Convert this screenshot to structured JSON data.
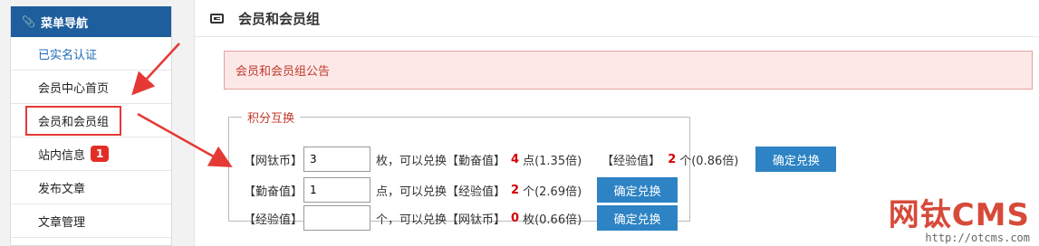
{
  "sidebar": {
    "header": "菜单导航",
    "items": [
      {
        "label": "已实名认证"
      },
      {
        "label": "会员中心首页"
      },
      {
        "label": "会员和会员组"
      },
      {
        "label": "站内信息",
        "badge": "1"
      },
      {
        "label": "发布文章"
      },
      {
        "label": "文章管理"
      }
    ]
  },
  "main": {
    "title": "会员和会员组",
    "notice": "会员和会员组公告",
    "legend": "积分互换",
    "rows": [
      {
        "label": "【网钛币】",
        "value": "3",
        "unit_text": "枚，可以兑换【勤奋值】",
        "num1": "4",
        "tail1": "点(1.35倍)",
        "label2": "【经验值】",
        "num2": "2",
        "tail2": "个(0.86倍)",
        "button": "确定兑换"
      },
      {
        "label": "【勤奋值】",
        "value": "1",
        "unit_text": "点，可以兑换【经验值】",
        "num1": "2",
        "tail1": "个(2.69倍)",
        "button": "确定兑换"
      },
      {
        "label": "【经验值】",
        "value": "",
        "unit_text": "个，可以兑换【网钛币】",
        "num1": "0",
        "tail1": "枚(0.66倍)",
        "button": "确定兑换"
      }
    ]
  },
  "watermark": {
    "brand": "网钛CMS",
    "url": "http://otcms.com"
  },
  "colors": {
    "sidebar_header": "#1e5e9c",
    "button": "#2d83c4",
    "highlight_red": "#d40000",
    "annotation_red": "#e53935"
  }
}
